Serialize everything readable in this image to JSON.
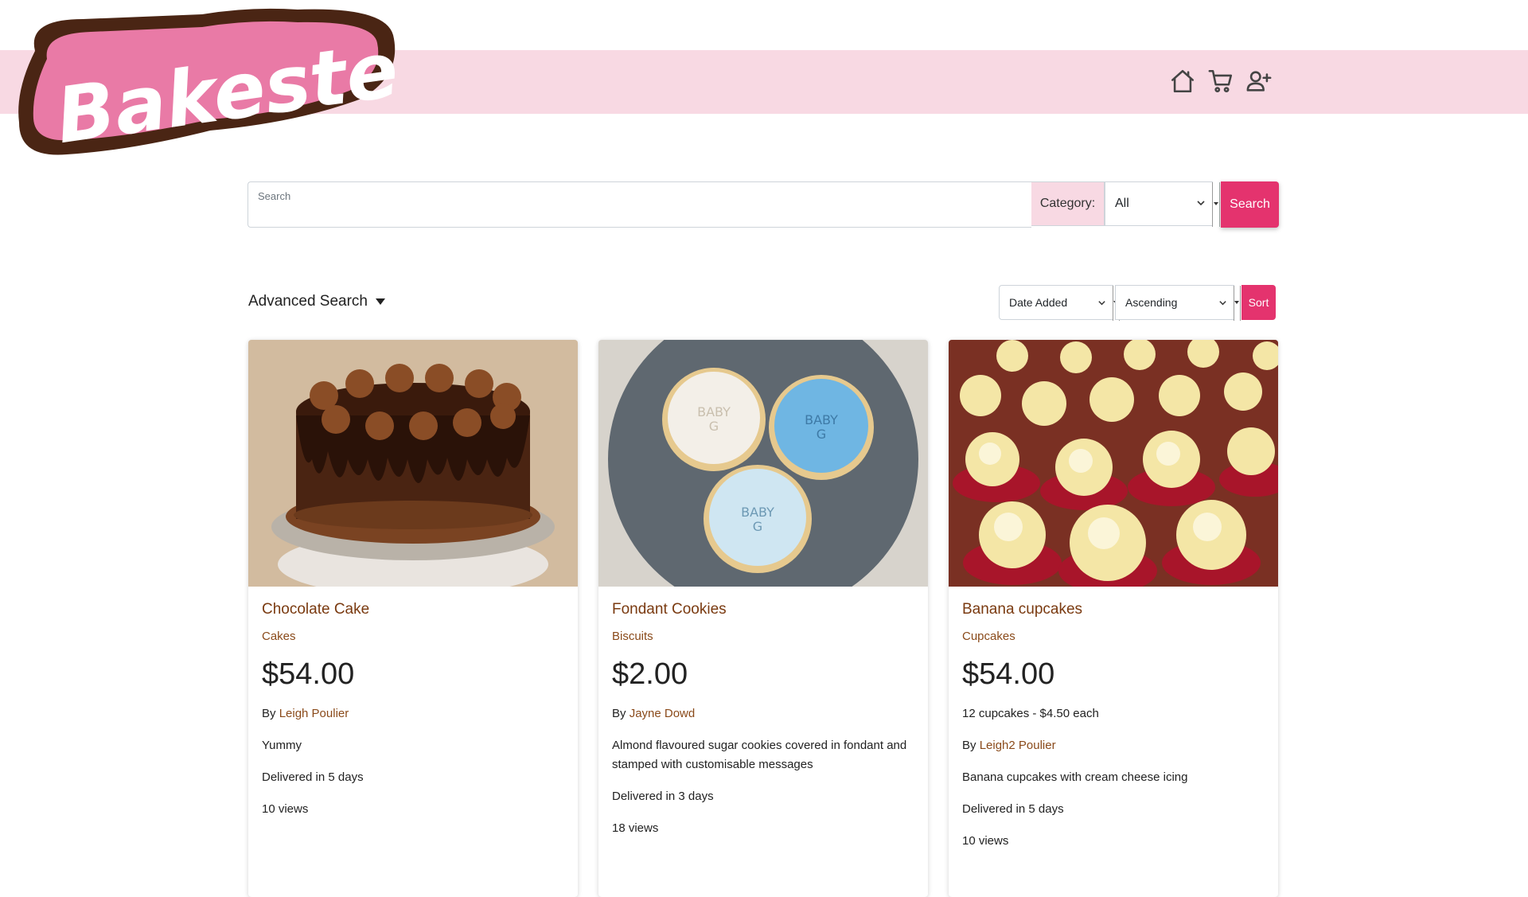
{
  "header": {
    "logo_text": "Bakester",
    "nav": [
      {
        "icon": "home-icon",
        "label": "Home"
      },
      {
        "icon": "cart-icon",
        "label": "Cart"
      },
      {
        "icon": "add-user-icon",
        "label": "Register"
      }
    ]
  },
  "search": {
    "placeholder": "Search",
    "value": "",
    "category_label": "Category:",
    "category_selected": "All",
    "button_label": "Search"
  },
  "advanced_search": {
    "label": "Advanced Search"
  },
  "sort": {
    "field_selected": "Date Added",
    "order_selected": "Ascending",
    "button_label": "Sort"
  },
  "colors": {
    "accent": "#e4336e",
    "header_band": "#f8d9e3",
    "link": "#8a4a1a"
  },
  "products": [
    {
      "image": "chocolate-cake-photo",
      "title": "Chocolate Cake",
      "category": "Cakes",
      "price": "$54.00",
      "quantity_note": "",
      "by_prefix": "By",
      "seller": "Leigh Poulier",
      "description": "Yummy",
      "delivery": "Delivered in 5 days",
      "views": "10 views"
    },
    {
      "image": "fondant-cookies-photo",
      "title": "Fondant Cookies",
      "category": "Biscuits",
      "price": "$2.00",
      "quantity_note": "",
      "by_prefix": "By",
      "seller": "Jayne Dowd",
      "description": "Almond flavoured sugar cookies covered in fondant and stamped with customisable messages",
      "delivery": "Delivered in 3 days",
      "views": "18 views"
    },
    {
      "image": "banana-cupcakes-photo",
      "title": "Banana cupcakes",
      "category": "Cupcakes",
      "price": "$54.00",
      "quantity_note": "12 cupcakes - $4.50 each",
      "by_prefix": "By",
      "seller": "Leigh2 Poulier",
      "description": "Banana cupcakes with cream cheese icing",
      "delivery": "Delivered in 5 days",
      "views": "10 views"
    }
  ]
}
